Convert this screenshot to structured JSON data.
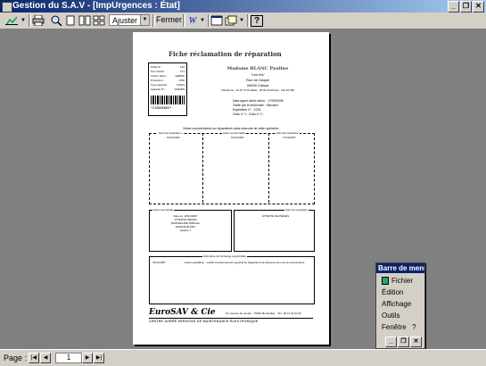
{
  "window": {
    "title": "Gestion du S.A.V - [ImpUrgences : État]",
    "buttons": [
      "_",
      "❐",
      "✕"
    ]
  },
  "toolbar": {
    "zoom_value": "Ajuster",
    "close_label": "Fermer",
    "word_label": "W",
    "help_label": "?"
  },
  "report": {
    "title": "Fiche réclamation de réparation",
    "info_rows": [
      {
        "label": "Fiche N° :",
        "value": "102"
      },
      {
        "label": "Nom fichier :",
        "value": "T17"
      },
      {
        "label": "Fichier client :",
        "value": "GEMINI"
      },
      {
        "label": "Protection :",
        "value": "OPD"
      },
      {
        "label": "Type appareil :",
        "value": "FC601"
      },
      {
        "label": "Appareil N° :",
        "value": "N/40005"
      }
    ],
    "barcode_number": "*210000005*",
    "customer_name": "Madame BLANC Pauline",
    "customer_lines": [
      "\"Les Iris\"",
      "Rue de Gaspé",
      "34000 Caissa",
      "Téléphone : 04 67 47     Portable : 06 60 23 00     Fax : 136 04 084"
    ],
    "meta_lines": [
      "Date appel client retour : 17/05/2006",
      "Traité par le technicien : Bernard",
      "Expédition n° : 1234",
      "Colis n° 1 :          Colis n° 2 :"
    ],
    "section_caption": "Notez commentaires ou réparations dans chacune de cette opération",
    "repair_columns": [
      "Suivi de réparation",
      "Autre commentaire",
      "Suivi de réparation"
    ],
    "repair_dates": [
      "15/11/2007",
      "16/11/2007",
      "17/11/2007"
    ],
    "client_box_label": "Suivi commande",
    "client_box_text": [
      "Date du: 26/11/2007",
      "ATTENTE PIÈCES",
      "PROCÉDURE SPÉCIAL",
      "AVANCÉ BLANC",
      "pauline ?"
    ],
    "right_box_text": "ATTENTE DE PIÈCES",
    "right_box_label": "Suivi de réparation",
    "action_label": "Historique de l'échange supportable",
    "action_date": "15/11/2007",
    "action_text": "Avant expédition : vérifier fonctionnement général de l'appareil et la présence de tous les accessoires",
    "company": "EuroSAV & Cie",
    "address": "15, Avenue du temple · 75000 Montpellier · Tél : 06 12 61 64 00",
    "tagline": "CENTRE AGRÉÉ SERVICES DE MAINTENANCE ÉLECTRONIQUE"
  },
  "status": {
    "page_label": "Page :",
    "page_number": "1"
  },
  "floatbar": {
    "title": "Barre de menu",
    "items": [
      "Fichier",
      "Édition",
      "Affichage",
      "Outils",
      "Fenêtre",
      "?"
    ]
  },
  "colors": {
    "titlebar": "#0a246a",
    "chrome": "#d4d0c8",
    "workspace": "#808080"
  }
}
